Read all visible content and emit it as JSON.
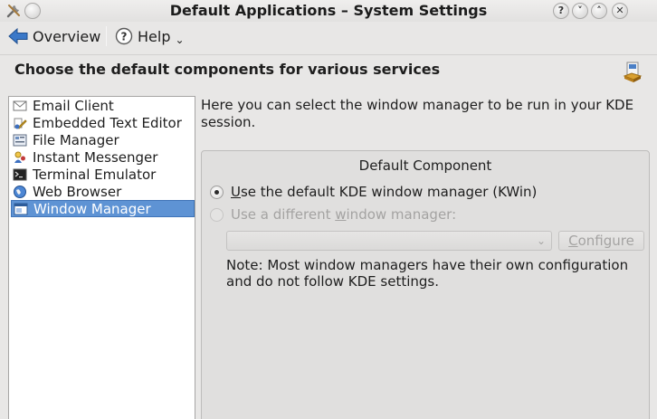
{
  "window": {
    "title": "Default Applications – System Settings",
    "buttons": [
      "?",
      "˅",
      "˄",
      "✕"
    ]
  },
  "toolbar": {
    "overview_label": "Overview",
    "help_label": "Help",
    "help_menu_arrow": "⌄"
  },
  "header": {
    "title": "Choose the default components for various services"
  },
  "sidebar": {
    "items": [
      {
        "label": "Email Client",
        "icon": "email-client-icon"
      },
      {
        "label": "Embedded Text Editor",
        "icon": "text-editor-icon"
      },
      {
        "label": "File Manager",
        "icon": "file-manager-icon"
      },
      {
        "label": "Instant Messenger",
        "icon": "instant-messenger-icon"
      },
      {
        "label": "Terminal Emulator",
        "icon": "terminal-icon"
      },
      {
        "label": "Web Browser",
        "icon": "web-browser-icon"
      },
      {
        "label": "Window Manager",
        "icon": "window-manager-icon",
        "selected": true
      }
    ]
  },
  "main": {
    "description": "Here you can select the window manager to be run in your KDE session.",
    "group_title": "Default Component",
    "radio_default": {
      "prefix": "",
      "underline": "U",
      "rest": "se the default KDE window manager (KWin)"
    },
    "radio_other": {
      "prefix": "Use a different ",
      "underline": "w",
      "rest": "indow manager:"
    },
    "combo_value": "",
    "configure_button": {
      "underline": "C",
      "rest": "onfigure"
    },
    "note": "Note: Most window managers have their own configuration and do not follow KDE settings."
  },
  "colors": {
    "selection": "#5e93d4",
    "background": "#e8e7e6"
  }
}
